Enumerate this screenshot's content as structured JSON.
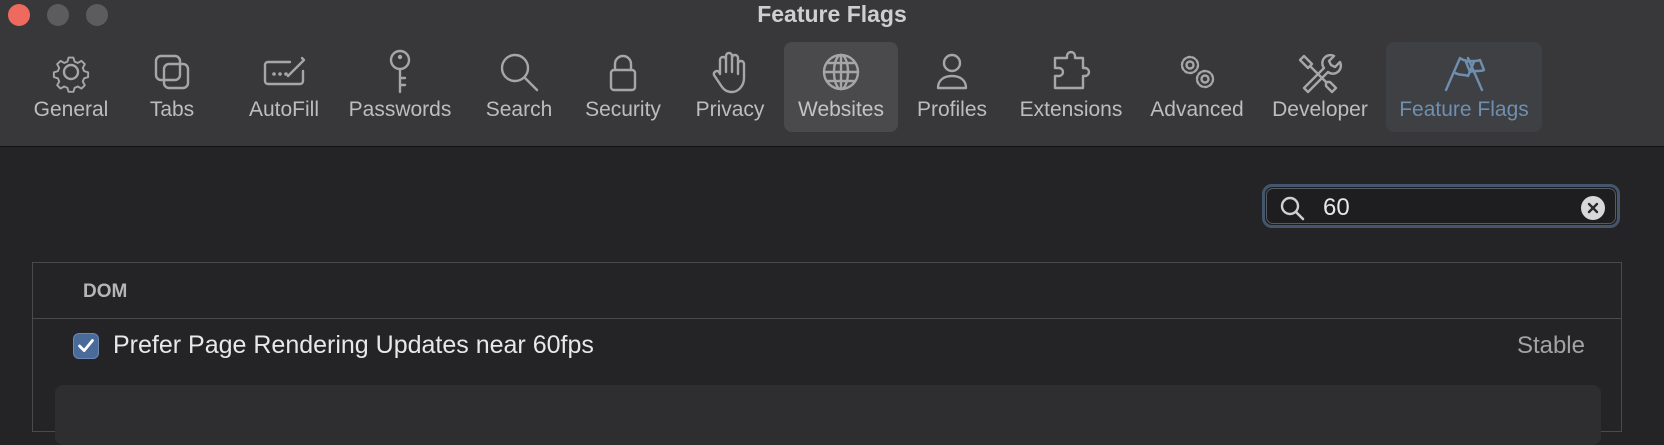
{
  "window": {
    "title": "Feature Flags"
  },
  "toolbar": {
    "tabs": [
      {
        "label": "General",
        "icon": "gear-icon"
      },
      {
        "label": "Tabs",
        "icon": "tabs-icon"
      },
      {
        "label": "AutoFill",
        "icon": "autofill-icon"
      },
      {
        "label": "Passwords",
        "icon": "key-icon"
      },
      {
        "label": "Search",
        "icon": "search-icon"
      },
      {
        "label": "Security",
        "icon": "lock-icon"
      },
      {
        "label": "Privacy",
        "icon": "hand-icon"
      },
      {
        "label": "Websites",
        "icon": "globe-icon"
      },
      {
        "label": "Profiles",
        "icon": "person-icon"
      },
      {
        "label": "Extensions",
        "icon": "puzzle-icon"
      },
      {
        "label": "Advanced",
        "icon": "gears-icon"
      },
      {
        "label": "Developer",
        "icon": "tools-icon"
      },
      {
        "label": "Feature Flags",
        "icon": "flags-icon"
      }
    ],
    "hover_tab": "Websites",
    "selected_tab": "Feature Flags"
  },
  "search": {
    "value": "60"
  },
  "sections": [
    {
      "title": "DOM",
      "items": [
        {
          "label": "Prefer Page Rendering Updates near 60fps",
          "status": "Stable",
          "checked": true
        }
      ]
    }
  ],
  "colors": {
    "accent": "#6e8fb0",
    "checkbox": "#4a6a9a",
    "close": "#ee6a5e"
  }
}
